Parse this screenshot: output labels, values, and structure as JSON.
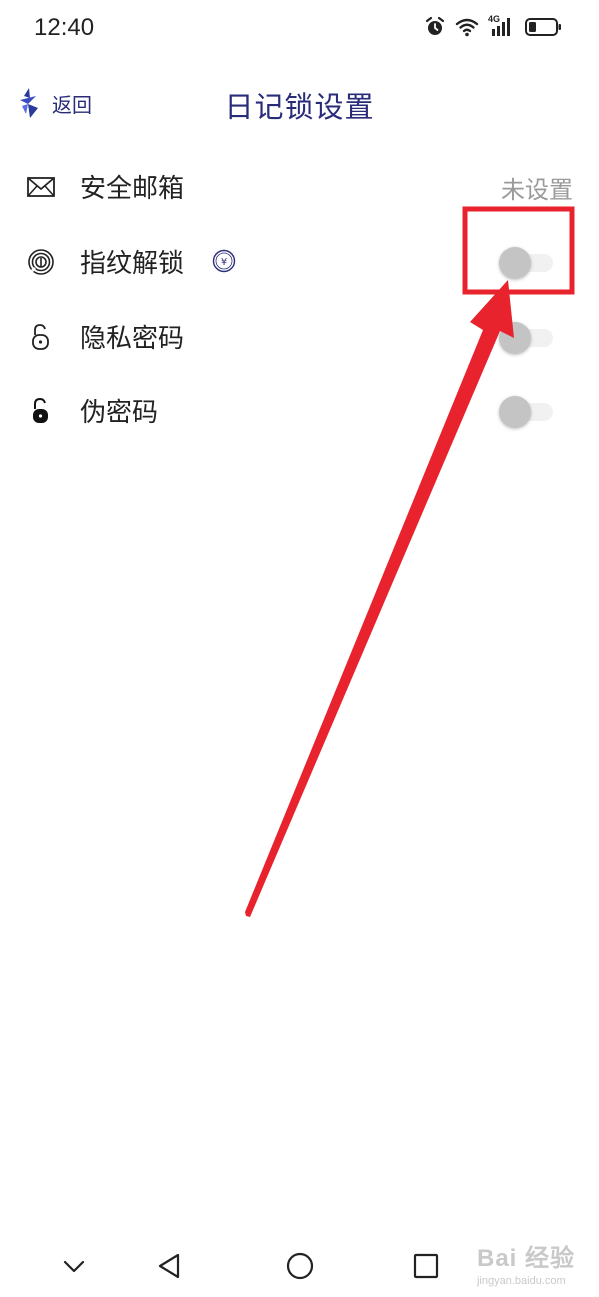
{
  "status_bar": {
    "time": "12:40",
    "network_label": "4G",
    "icons": [
      "alarm-icon",
      "wifi-icon",
      "signal-icon",
      "battery-icon"
    ]
  },
  "header": {
    "back_label": "返回",
    "title": "日记锁设置"
  },
  "settings": [
    {
      "icon": "mail-icon",
      "label": "安全邮箱",
      "value": "未设置"
    },
    {
      "icon": "fingerprint-icon",
      "label": "指纹解锁",
      "badge": "¥",
      "toggle_on": false
    },
    {
      "icon": "lock-outline-icon",
      "label": "隐私密码",
      "toggle_on": false
    },
    {
      "icon": "lock-filled-icon",
      "label": "伪密码",
      "toggle_on": false
    }
  ],
  "nav_bar": {
    "icons": [
      "chevron-down-icon",
      "back-triangle-icon",
      "home-circle-icon",
      "recents-square-icon"
    ]
  },
  "watermark": {
    "main": "Bai 经验",
    "sub": "jingyan.baidu.com"
  },
  "colors": {
    "accent": "#2a2c7a",
    "annotation_red": "#e8232e",
    "muted_text": "#9a9a9a",
    "toggle_knob": "#c4c4c4"
  }
}
